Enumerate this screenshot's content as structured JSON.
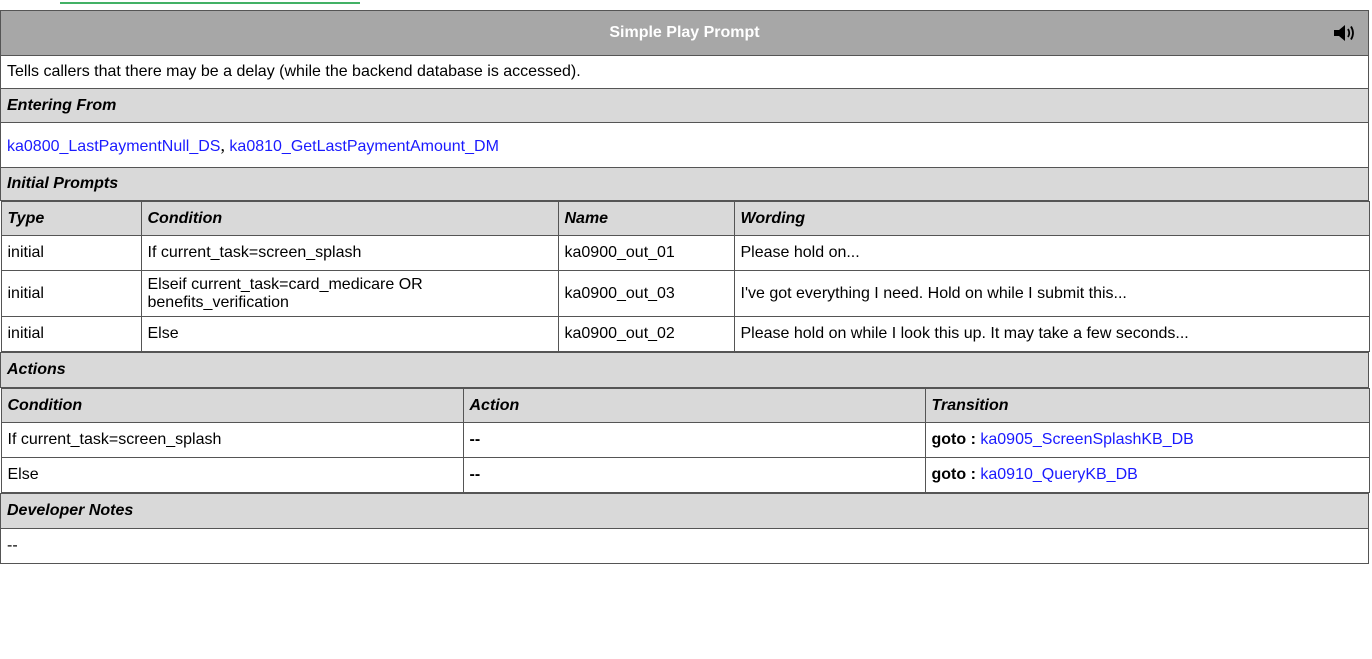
{
  "title": "Simple Play Prompt",
  "description": "Tells callers that there may be a delay (while the backend database is accessed).",
  "entering_from": {
    "label": "Entering From",
    "links": [
      "ka0800_LastPaymentNull_DS",
      "ka0810_GetLastPaymentAmount_DM"
    ],
    "separator": ","
  },
  "initial_prompts": {
    "label": "Initial Prompts",
    "headers": [
      "Type",
      "Condition",
      "Name",
      "Wording"
    ],
    "rows": [
      {
        "type": "initial",
        "condition": "If current_task=screen_splash",
        "name": "ka0900_out_01",
        "wording": "Please hold on..."
      },
      {
        "type": "initial",
        "condition": "Elseif current_task=card_medicare OR benefits_verification",
        "name": "ka0900_out_03",
        "wording": "I've got everything I need. Hold on while I submit this..."
      },
      {
        "type": "initial",
        "condition": "Else",
        "name": "ka0900_out_02",
        "wording": "Please hold on while I look this up. It may take a few seconds..."
      }
    ]
  },
  "actions": {
    "label": "Actions",
    "headers": [
      "Condition",
      "Action",
      "Transition"
    ],
    "rows": [
      {
        "condition": "If current_task=screen_splash",
        "action": "--",
        "goto_label": "goto :",
        "target": "ka0905_ScreenSplashKB_DB"
      },
      {
        "condition": "Else",
        "action": "--",
        "goto_label": "goto :",
        "target": "ka0910_QueryKB_DB"
      }
    ]
  },
  "developer_notes": {
    "label": "Developer Notes",
    "text": "--"
  },
  "icons": {
    "speaker": "speaker-icon"
  },
  "colors": {
    "title_bg": "#a7a7a7",
    "section_bg": "#d9d9d9",
    "link": "#1a1aff"
  }
}
